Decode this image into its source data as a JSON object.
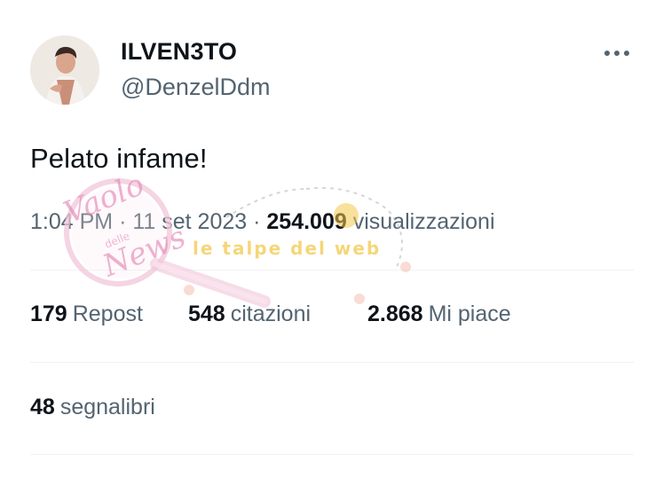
{
  "user": {
    "display_name": "ILVEN3TO",
    "handle": "@DenzelDdm"
  },
  "tweet": {
    "text": "Pelato infame!",
    "time": "1:04 PM",
    "separator": "·",
    "date": "11 set 2023",
    "views_count": "254.009",
    "views_label": "visualizzazioni"
  },
  "stats": {
    "reposts": {
      "count": "179",
      "label": "Repost"
    },
    "quotes": {
      "count": "548",
      "label": "citazioni"
    },
    "likes": {
      "count": "2.868",
      "label": "Mi piace"
    },
    "bookmarks": {
      "count": "48",
      "label": "segnalibri"
    }
  },
  "watermarks": {
    "left_line1": "Vaolo",
    "left_line2": "delle",
    "left_line3": "News",
    "right": "le talpe del web"
  },
  "icons": {
    "more": "more-horizontal-icon"
  },
  "colors": {
    "text_primary": "#0f1419",
    "text_secondary": "#536471",
    "divider": "#eff3f4",
    "watermark_pink": "#e89ac0",
    "watermark_yellow": "#f2c94c"
  }
}
